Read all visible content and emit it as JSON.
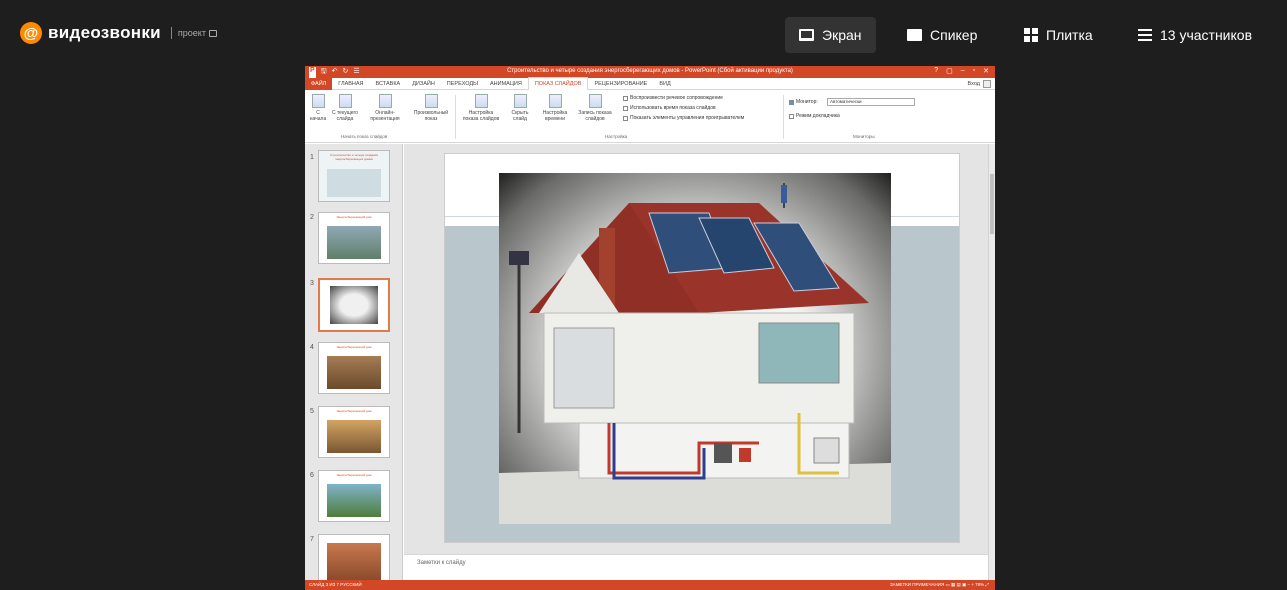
{
  "app": {
    "logo_text": "видеозвонки",
    "logo_sub": "проект"
  },
  "views": [
    {
      "label": "Экран",
      "icon": "screen-icon",
      "active": true
    },
    {
      "label": "Спикер",
      "icon": "speaker-icon",
      "active": false
    },
    {
      "label": "Плитка",
      "icon": "tile-icon",
      "active": false
    },
    {
      "label": "13 участников",
      "icon": "participants-list-icon",
      "active": false
    }
  ],
  "powerpoint": {
    "title": "Строительство и четыре создания энергосберегающих домов - PowerPoint (Сбой активации продукта)",
    "window_controls": [
      "?",
      "▢",
      "–",
      "▫",
      "✕"
    ],
    "quick_access": [
      "P",
      "🖫",
      "↶",
      "↻",
      "☰"
    ],
    "tabs": [
      "ФАЙЛ",
      "ГЛАВНАЯ",
      "ВСТАВКА",
      "ДИЗАЙН",
      "ПЕРЕХОДЫ",
      "АНИМАЦИЯ",
      "ПОКАЗ СЛАЙДОВ",
      "РЕЦЕНЗИРОВАНИЕ",
      "ВИД"
    ],
    "selected_tab": "ПОКАЗ СЛАЙДОВ",
    "user": "Вход",
    "ribbon_buttons": [
      {
        "label": "С начала"
      },
      {
        "label": "С текущего слайда"
      },
      {
        "label": "Онлайн-презентация"
      },
      {
        "label": "Произвольный показ"
      },
      {
        "label": "Настройка показа слайдов"
      },
      {
        "label": "Скрыть слайд"
      },
      {
        "label": "Настройка времени"
      },
      {
        "label": "Запись показа слайдов"
      }
    ],
    "checkboxes": [
      "Воспроизвести речевое сопровождение",
      "Использовать время показа слайдов",
      "Показать элементы управления проигрывателем"
    ],
    "monitor_label": "Монитор:",
    "monitor_value": "Автоматически",
    "presenter_view": "Режим докладчика",
    "groups": [
      "Начать показ слайдов",
      "Настройка",
      "Мониторы"
    ],
    "thumbnails": [
      {
        "num": "1",
        "title": "Строительство и четыре создания энергосберегающих домов"
      },
      {
        "num": "2",
        "title": "Энергосберегающий дом"
      },
      {
        "num": "3",
        "title": ""
      },
      {
        "num": "4",
        "title": "Энергосберегающий дом"
      },
      {
        "num": "5",
        "title": "Энергосберегающий дом"
      },
      {
        "num": "6",
        "title": "Энергосберегающий дом"
      },
      {
        "num": "7",
        "title": ""
      }
    ],
    "selected_thumb": "3",
    "notes_placeholder": "Заметки к слайду",
    "status_left": "СЛАЙД 3 ИЗ 7    РУССКИЙ",
    "status_right": "ЗАМЕТКИ   ПРИМЕЧАНИЯ    ▭  ▦  ▤  ▣   –  +  78%  ⤢"
  }
}
